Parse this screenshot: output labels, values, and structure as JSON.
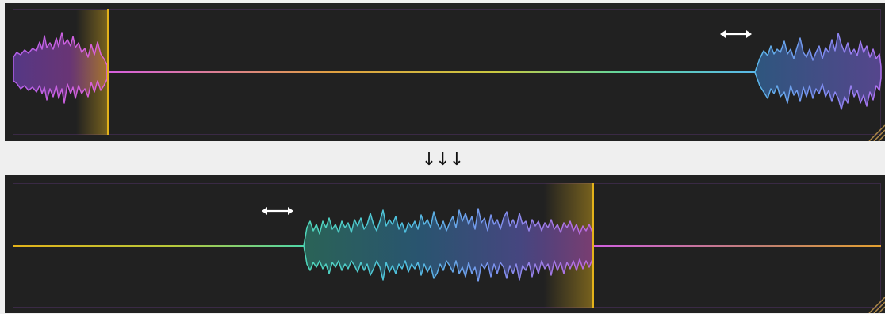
{
  "transition": {
    "arrows": "↓↓↓"
  },
  "panels": [
    {
      "id": "before",
      "move_icon": "double-arrow-horizontal-icon",
      "playhead_color": "#e3b21a"
    },
    {
      "id": "after",
      "move_icon": "double-arrow-horizontal-icon",
      "playhead_color": "#e3b21a"
    }
  ],
  "colors": {
    "panel_bg": "#212121",
    "frame": "#3a2a45",
    "magenta": "#d65fe0",
    "violet": "#9a6cf0",
    "blue": "#6ea8f0",
    "cyan": "#4fd6d0",
    "green": "#7fd46a",
    "yellow": "#e3b21a"
  }
}
